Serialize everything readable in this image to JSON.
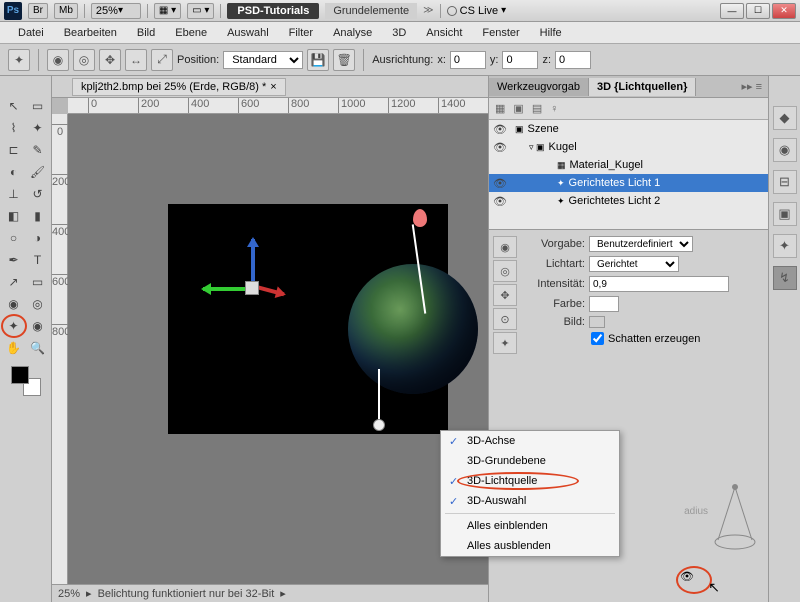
{
  "titlebar": {
    "app": "Ps",
    "br": "Br",
    "mb": "Mb",
    "zoom": "25%",
    "tab_dark": "PSD-Tutorials",
    "tab_light": "Grundelemente",
    "cs_live": "CS Live"
  },
  "menubar": [
    "Datei",
    "Bearbeiten",
    "Bild",
    "Ebene",
    "Auswahl",
    "Filter",
    "Analyse",
    "3D",
    "Ansicht",
    "Fenster",
    "Hilfe"
  ],
  "optionsbar": {
    "position_label": "Position:",
    "position_value": "Standard",
    "ausrichtung_label": "Ausrichtung:",
    "x_label": "x:",
    "x_val": "0",
    "y_label": "y:",
    "y_val": "0",
    "z_label": "z:",
    "z_val": "0"
  },
  "document": {
    "tab": "kplj2th2.bmp bei 25% (Erde, RGB/8) *",
    "ruler_h": [
      "0",
      "200",
      "400",
      "600",
      "800",
      "1000",
      "1200",
      "1400"
    ],
    "ruler_v": [
      "0",
      "200",
      "400",
      "600",
      "800"
    ]
  },
  "status": {
    "zoom": "25%",
    "msg": "Belichtung funktioniert nur bei 32-Bit"
  },
  "panel3d": {
    "tab1": "Werkzeugvorgab",
    "tab2": "3D {Lichtquellen}",
    "tree": [
      {
        "label": "Szene",
        "indent": 0,
        "eye": true,
        "icon": "▣"
      },
      {
        "label": "Kugel",
        "indent": 1,
        "eye": true,
        "icon": "▿ ▣",
        "tri": true
      },
      {
        "label": "Material_Kugel",
        "indent": 3,
        "eye": false,
        "icon": "▦"
      },
      {
        "label": "Gerichtetes Licht 1",
        "indent": 3,
        "eye": true,
        "icon": "✦",
        "sel": true
      },
      {
        "label": "Gerichtetes Licht 2",
        "indent": 3,
        "eye": true,
        "icon": "✦"
      }
    ],
    "vorgabe_label": "Vorgabe:",
    "vorgabe_value": "Benutzerdefiniert",
    "lichtart_label": "Lichtart:",
    "lichtart_value": "Gerichtet",
    "intensitaet_label": "Intensität:",
    "intensitaet_value": "0,9",
    "farbe_label": "Farbe:",
    "bild_label": "Bild:",
    "schatten_label": "Schatten erzeugen",
    "radius_label": "adius"
  },
  "context_menu": {
    "items": [
      {
        "label": "3D-Achse",
        "checked": true
      },
      {
        "label": "3D-Grundebene",
        "checked": false
      },
      {
        "label": "3D-Lichtquelle",
        "checked": true,
        "circled": true
      },
      {
        "label": "3D-Auswahl",
        "checked": true
      }
    ],
    "sep_items": [
      "Alles einblenden",
      "Alles ausblenden"
    ]
  }
}
